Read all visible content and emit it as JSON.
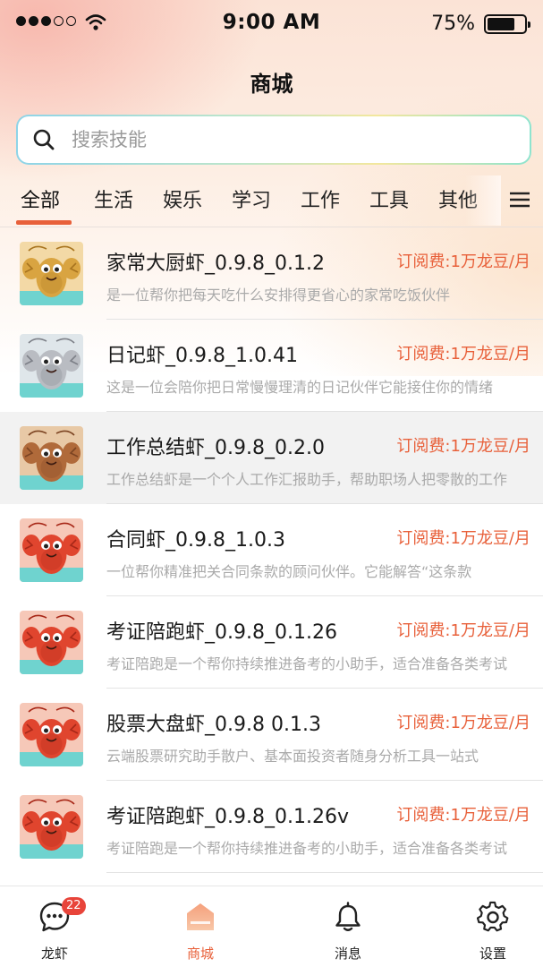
{
  "status_bar": {
    "time": "9:00 AM",
    "battery": "75%",
    "battery_level": 0.75
  },
  "header": {
    "title": "商城"
  },
  "search": {
    "placeholder": "搜索技能"
  },
  "tabs": [
    {
      "label": "全部",
      "active": true
    },
    {
      "label": "生活"
    },
    {
      "label": "娱乐"
    },
    {
      "label": "学习"
    },
    {
      "label": "工作"
    },
    {
      "label": "工具"
    },
    {
      "label": "其他"
    }
  ],
  "items": [
    {
      "name": "家常大厨虾_0.9.8_0.1.2",
      "price": "订阅费:1万龙豆/月",
      "desc": "是一位帮你把每天吃什么安排得更省心的家常吃饭伙伴",
      "avatar_color": "gold"
    },
    {
      "name": "日记虾_0.9.8_1.0.41",
      "price": "订阅费:1万龙豆/月",
      "desc": "这是一位会陪你把日常慢慢理清的日记伙伴它能接住你的情绪",
      "avatar_color": "silver"
    },
    {
      "name": "工作总结虾_0.9.8_0.2.0",
      "price": "订阅费:1万龙豆/月",
      "desc": "工作总结虾是一个个人工作汇报助手，帮助职场人把零散的工作",
      "avatar_color": "bronze"
    },
    {
      "name": "合同虾_0.9.8_1.0.3",
      "price": "订阅费:1万龙豆/月",
      "desc": "一位帮你精准把关合同条款的顾问伙伴。它能解答“这条款",
      "avatar_color": "red"
    },
    {
      "name": "考证陪跑虾_0.9.8_0.1.26",
      "price": "订阅费:1万龙豆/月",
      "desc": "考证陪跑是一个帮你持续推进备考的小助手，适合准备各类考试",
      "avatar_color": "red"
    },
    {
      "name": "股票大盘虾_0.9.8 0.1.3",
      "price": "订阅费:1万龙豆/月",
      "desc": "云端股票研究助手散户、基本面投资者随身分析工具一站式",
      "avatar_color": "red"
    },
    {
      "name": "考证陪跑虾_0.9.8_0.1.26v",
      "price": "订阅费:1万龙豆/月",
      "desc": "考证陪跑是一个帮你持续推进备考的小助手，适合准备各类考试",
      "avatar_color": "red"
    }
  ],
  "bottom_nav": [
    {
      "label": "龙虾",
      "badge": "22"
    },
    {
      "label": "商城",
      "active": true
    },
    {
      "label": "消息"
    },
    {
      "label": "设置"
    }
  ],
  "colors": {
    "accent": "#e8603a",
    "badge": "#e8443a"
  }
}
